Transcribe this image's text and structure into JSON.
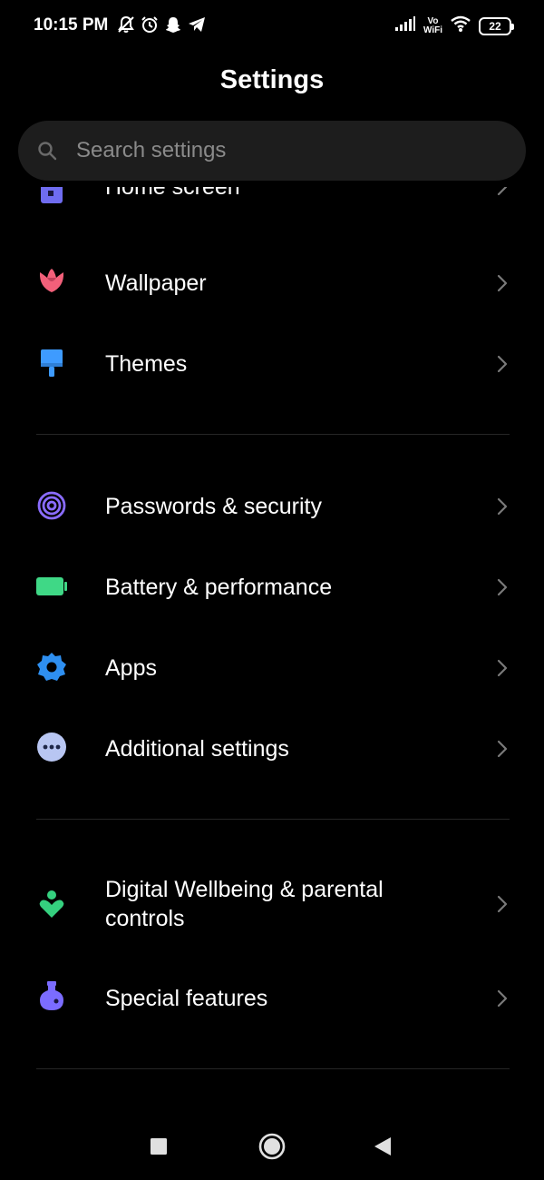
{
  "status_bar": {
    "time": "10:15 PM",
    "volte_line1": "Vo",
    "volte_line2": "WiFi",
    "battery_level": "22"
  },
  "header": {
    "title": "Settings"
  },
  "search": {
    "placeholder": "Search settings"
  },
  "items": {
    "home_screen": {
      "label": "Home screen",
      "icon": "home-screen-icon",
      "color": "#6f6cf0"
    },
    "wallpaper": {
      "label": "Wallpaper",
      "icon": "tulip-icon",
      "color": "#f2607a"
    },
    "themes": {
      "label": "Themes",
      "icon": "paint-roller-icon",
      "color": "#3e9bff"
    },
    "passwords": {
      "label": "Passwords & security",
      "icon": "fingerprint-icon",
      "color": "#8a6cff"
    },
    "battery": {
      "label": "Battery & performance",
      "icon": "battery-icon",
      "color": "#3fd886"
    },
    "apps": {
      "label": "Apps",
      "icon": "gear-icon",
      "color": "#2e8ff0"
    },
    "additional": {
      "label": "Additional settings",
      "icon": "more-dots-icon",
      "color": "#b8c6f2"
    },
    "digital_wellbeing": {
      "label_line1": "Digital Wellbeing & parental",
      "label_line2": "controls",
      "icon": "wellbeing-icon",
      "color": "#35d07f"
    },
    "special_features": {
      "label": "Special features",
      "icon": "flask-icon",
      "color": "#7b6cff"
    }
  },
  "nav": {
    "recents": "recents-icon",
    "home": "home-icon",
    "back": "back-icon"
  }
}
